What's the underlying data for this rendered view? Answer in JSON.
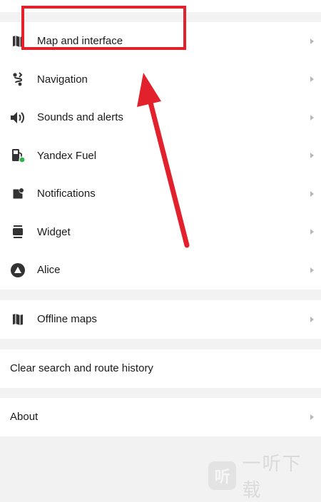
{
  "groups": [
    {
      "items": [
        {
          "label": "Map and interface",
          "icon": "map-icon"
        },
        {
          "label": "Navigation",
          "icon": "route-icon"
        },
        {
          "label": "Sounds and alerts",
          "icon": "speaker-icon"
        },
        {
          "label": "Yandex Fuel",
          "icon": "fuel-icon"
        },
        {
          "label": "Notifications",
          "icon": "notification-icon"
        },
        {
          "label": "Widget",
          "icon": "widget-icon"
        },
        {
          "label": "Alice",
          "icon": "alice-icon"
        }
      ]
    },
    {
      "items": [
        {
          "label": "Offline maps",
          "icon": "map-icon"
        }
      ]
    },
    {
      "items": [
        {
          "label": "Clear search and route history"
        }
      ]
    },
    {
      "items": [
        {
          "label": "About"
        }
      ]
    }
  ],
  "annotation": {
    "highlight_color": "#e3212d"
  },
  "watermark": {
    "badge": "听",
    "text": "一听下载"
  },
  "colors": {
    "status_dot": "#2db34a",
    "background": "#f2f2f2",
    "chevron": "#b8b8b8"
  }
}
